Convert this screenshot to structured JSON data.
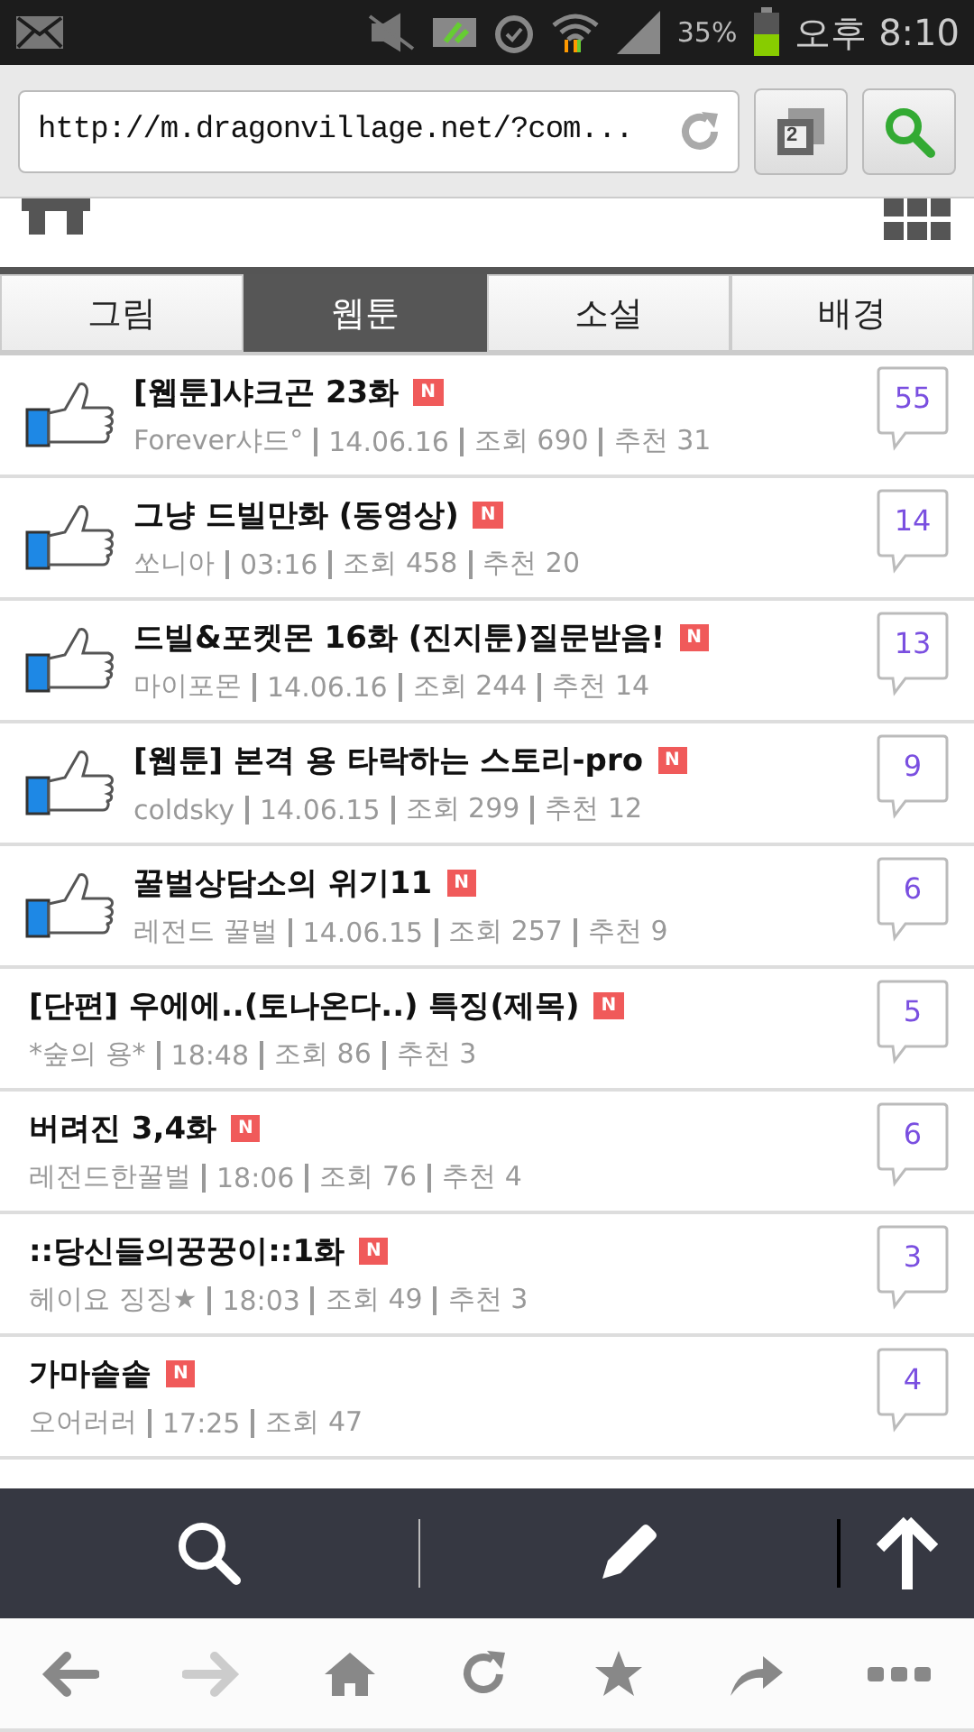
{
  "status_bar": {
    "battery_text": "35%",
    "time": "오후 8:10"
  },
  "address_bar": {
    "url": "http://m.dragonvillage.net/?com...",
    "tab_count": "2"
  },
  "tabs": [
    {
      "label": "그림",
      "selected": false
    },
    {
      "label": "웹툰",
      "selected": true
    },
    {
      "label": "소설",
      "selected": false
    },
    {
      "label": "배경",
      "selected": false
    }
  ],
  "posts": [
    {
      "kind": "recommended",
      "title": "[웹툰]샤크곤 23화",
      "badge": "N",
      "meta": [
        "Forever샤드°",
        "14.06.16",
        "조회 690",
        "추천 31"
      ],
      "comments": "55"
    },
    {
      "kind": "recommended",
      "title": "그냥 드빌만화 (동영상)",
      "badge": "N",
      "meta": [
        "쏘니아",
        "03:16",
        "조회 458",
        "추천 20"
      ],
      "comments": "14"
    },
    {
      "kind": "recommended",
      "title": "드빌&포켓몬 16화 (진지툰)질문받음!",
      "badge": "N",
      "meta": [
        "마이포몬",
        "14.06.16",
        "조회 244",
        "추천 14"
      ],
      "comments": "13"
    },
    {
      "kind": "recommended",
      "title": "[웹툰] 본격 용 타락하는 스토리-pro",
      "badge": "N",
      "meta": [
        "coldsky",
        "14.06.15",
        "조회 299",
        "추천 12"
      ],
      "comments": "9"
    },
    {
      "kind": "recommended",
      "title": "꿀벌상담소의 위기11",
      "badge": "N",
      "meta": [
        "레전드 꿀벌",
        "14.06.15",
        "조회 257",
        "추천 9"
      ],
      "comments": "6"
    },
    {
      "kind": "plain",
      "title": "[단편] 우에에..(토나온다..) 특징(제목)",
      "badge": "N",
      "meta": [
        "*숲의 용*",
        "18:48",
        "조회 86",
        "추천 3"
      ],
      "comments": "5"
    },
    {
      "kind": "plain",
      "title": "버려진 3,4화",
      "badge": "N",
      "meta": [
        "레전드한꿀벌",
        "18:06",
        "조회 76",
        "추천 4"
      ],
      "comments": "6"
    },
    {
      "kind": "plain",
      "title": "::당신들의꿍꿍이::1화",
      "badge": "N",
      "meta": [
        "헤이요 징징★",
        "18:03",
        "조회 49",
        "추천 3"
      ],
      "comments": "3"
    },
    {
      "kind": "plain",
      "title": "가마솥솥",
      "badge": "N",
      "meta": [
        "오어러러",
        "17:25",
        "조회 47"
      ],
      "comments": "4"
    }
  ]
}
